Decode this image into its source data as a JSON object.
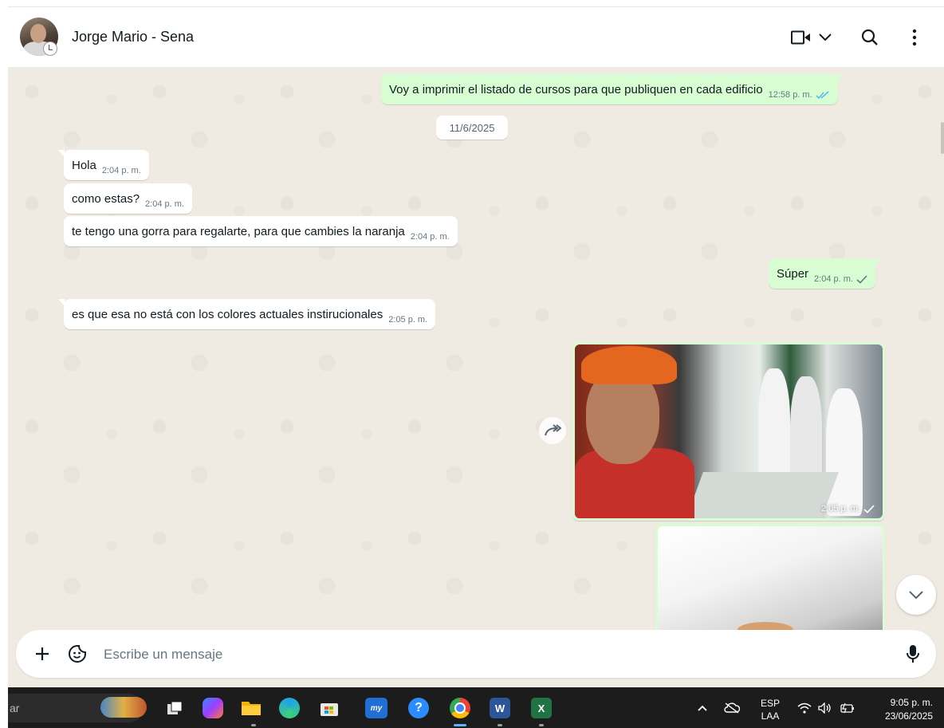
{
  "header": {
    "contact_name": "Jorge Mario - Sena"
  },
  "chat": {
    "date_separator": "11/6/2025",
    "messages": [
      {
        "dir": "out",
        "text": "Voy a imprimir el listado de cursos para que publiquen en cada edificio",
        "time": "12:58 p. m.",
        "status": "read"
      },
      {
        "dir": "in",
        "text": "Hola",
        "time": "2:04 p. m."
      },
      {
        "dir": "in",
        "text": "como estas?",
        "time": "2:04 p. m."
      },
      {
        "dir": "in",
        "text": "te tengo una gorra para regalarte, para que cambies la naranja",
        "time": "2:04 p. m."
      },
      {
        "dir": "out",
        "text": "Súper",
        "time": "2:04 p. m.",
        "status": "sent"
      },
      {
        "dir": "in",
        "text": "es que esa no está con los colores actuales instirucionales",
        "time": "2:05 p. m."
      },
      {
        "dir": "out",
        "type": "image",
        "time": "2:05 p. m.",
        "status": "sent"
      }
    ]
  },
  "composer": {
    "placeholder": "Escribe un mensaje"
  },
  "taskbar": {
    "search_text": "ar",
    "lang_line1": "ESP",
    "lang_line2": "LAA",
    "time": "9:05 p. m.",
    "date": "23/06/2025"
  },
  "colors": {
    "chat_bg": "#efeae2",
    "incoming_bubble": "#ffffff",
    "outgoing_bubble": "#d9fdd3",
    "read_tick": "#53bdeb",
    "taskbar_bg": "#1c1c1c"
  }
}
